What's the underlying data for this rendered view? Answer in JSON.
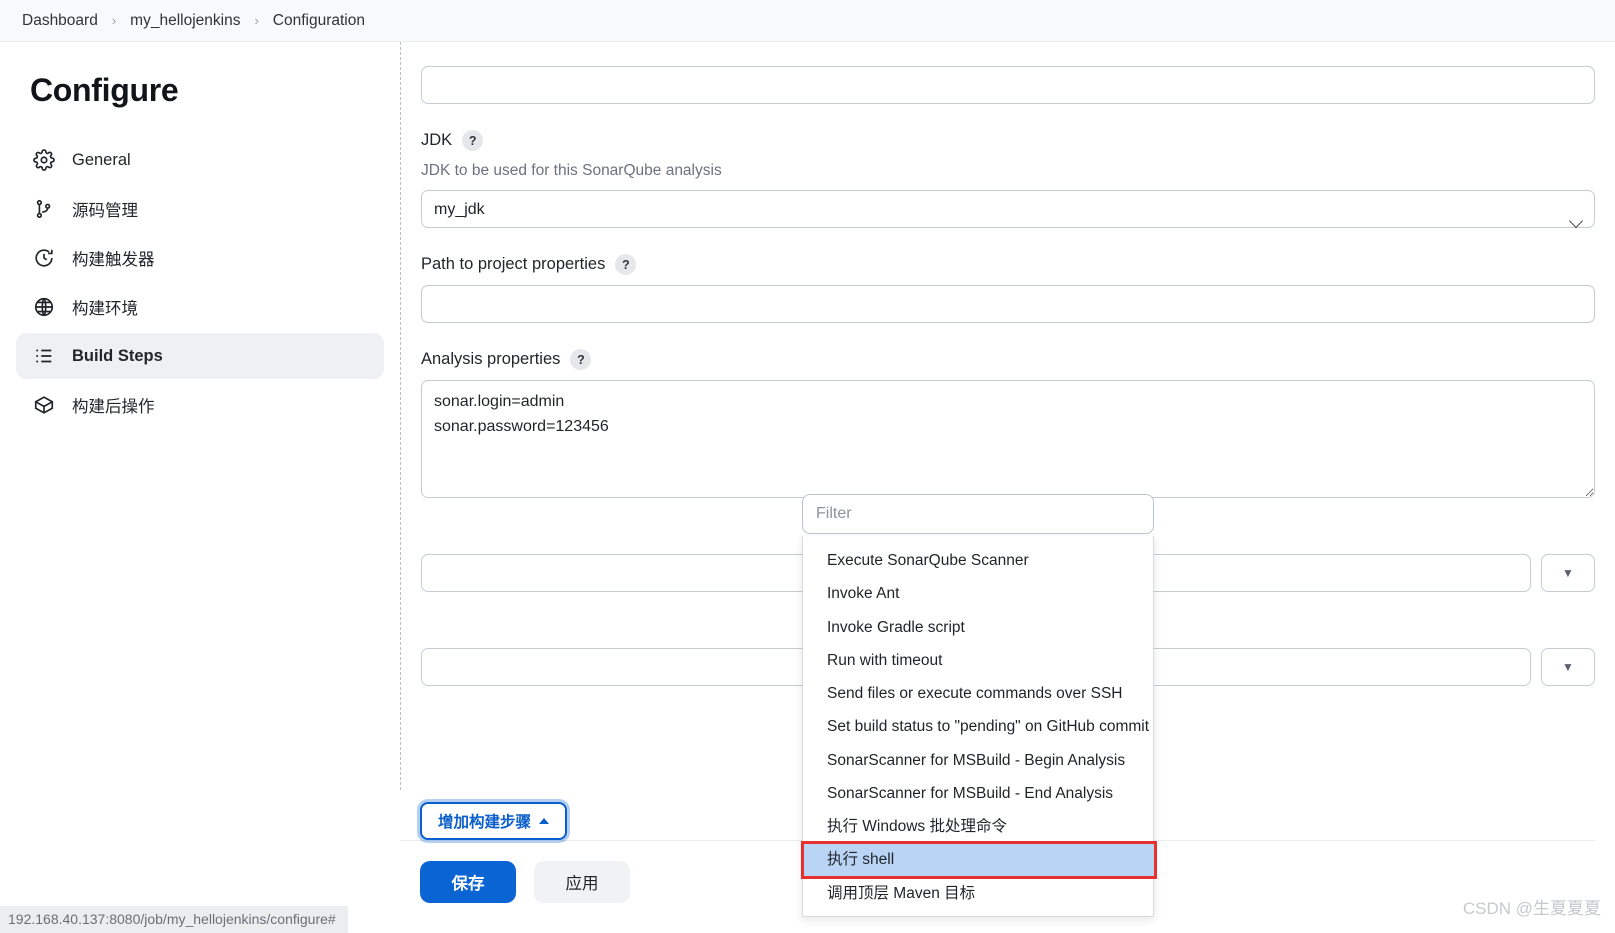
{
  "breadcrumb": {
    "items": [
      {
        "label": "Dashboard"
      },
      {
        "label": "my_hellojenkins"
      },
      {
        "label": "Configuration"
      }
    ],
    "separator": "›"
  },
  "sidebar": {
    "title": "Configure",
    "items": [
      {
        "label": "General",
        "icon": "gear-icon",
        "active": false
      },
      {
        "label": "源码管理",
        "icon": "git-branch-icon",
        "active": false
      },
      {
        "label": "构建触发器",
        "icon": "clock-icon",
        "active": false
      },
      {
        "label": "构建环境",
        "icon": "globe-icon",
        "active": false
      },
      {
        "label": "Build Steps",
        "icon": "list-icon",
        "active": true
      },
      {
        "label": "构建后操作",
        "icon": "package-icon",
        "active": false
      }
    ]
  },
  "form": {
    "top_input": {
      "value": "",
      "placeholder": ""
    },
    "jdk": {
      "label": "JDK",
      "help": "?",
      "description": "JDK to be used for this SonarQube analysis",
      "value": "my_jdk"
    },
    "path_to_project_properties": {
      "label": "Path to project properties",
      "help": "?",
      "value": "",
      "placeholder": ""
    },
    "analysis_properties": {
      "label": "Analysis properties",
      "help": "?",
      "value": "sonar.login=admin\nsonar.password=123456"
    },
    "combo_rows": [
      {
        "value": "",
        "placeholder": "",
        "button_icon": "▼"
      },
      {
        "value": "",
        "placeholder": "",
        "button_icon": "▼"
      }
    ],
    "add_build_step_button": "增加构建步骤"
  },
  "build_step_popup": {
    "filter_placeholder": "Filter",
    "filter_value": "",
    "items": [
      {
        "label": "Execute SonarQube Scanner",
        "selected": false
      },
      {
        "label": "Invoke Ant",
        "selected": false
      },
      {
        "label": "Invoke Gradle script",
        "selected": false
      },
      {
        "label": "Run with timeout",
        "selected": false
      },
      {
        "label": "Send files or execute commands over SSH",
        "selected": false
      },
      {
        "label": "Set build status to \"pending\" on GitHub commit",
        "selected": false
      },
      {
        "label": "SonarScanner for MSBuild - Begin Analysis",
        "selected": false
      },
      {
        "label": "SonarScanner for MSBuild - End Analysis",
        "selected": false
      },
      {
        "label": "执行 Windows 批处理命令",
        "selected": false
      },
      {
        "label": "执行 shell",
        "selected": true
      },
      {
        "label": "调用顶层 Maven 目标",
        "selected": false
      }
    ]
  },
  "actions": {
    "save_label": "保存",
    "apply_label": "应用"
  },
  "status_bar": {
    "url": "192.168.40.137:8080/job/my_hellojenkins/configure#"
  },
  "watermark": {
    "text": "CSDN @生夏夏夏"
  },
  "colors": {
    "accent": "#0b64d4",
    "annotation_red": "#e8312f",
    "selection_blue": "#b9d4f5",
    "sidebar_active": "#eef0f4"
  }
}
